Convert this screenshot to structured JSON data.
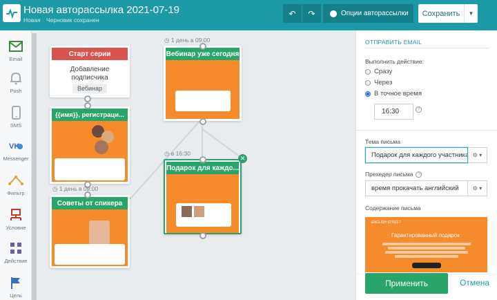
{
  "header": {
    "title": "Новая авторассылка 2021-07-19",
    "status_new": "Новая",
    "status_draft": "Черновик сохранен",
    "options_label": "Опции авторассылки",
    "save_label": "Сохранить",
    "undo_icon": "undo-icon",
    "redo_icon": "redo-icon"
  },
  "sidebar": {
    "items": [
      {
        "label": "Email",
        "icon": "email-icon",
        "color": "#3b8a3e"
      },
      {
        "label": "Push",
        "icon": "push-bell-icon",
        "color": "#a2acb1"
      },
      {
        "label": "SMS",
        "icon": "sms-phone-icon",
        "color": "#a2acb1"
      },
      {
        "label": "Messenger",
        "icon": "messenger-icon",
        "color": "#3b6fb8"
      },
      {
        "label": "Фильтр",
        "icon": "filter-icon",
        "color": "#e3a23a"
      },
      {
        "label": "Условие",
        "icon": "condition-icon",
        "color": "#c0392b"
      },
      {
        "label": "Действие",
        "icon": "action-icon",
        "color": "#6a5ea8"
      },
      {
        "label": "Цель",
        "icon": "goal-flag-icon",
        "color": "#3b6fb8"
      }
    ]
  },
  "canvas": {
    "start_node": {
      "header": "Старт серии",
      "line1": "Добавление",
      "line2": "подписчика",
      "button": "Вебинар"
    },
    "node_reg": {
      "header": "{{имя}}, регистраци..."
    },
    "node_tips": {
      "header": "Советы от спикера",
      "timing": "1 день в 09:00"
    },
    "node_webinar": {
      "header": "Вебинар уже сегодня",
      "timing": "1 день в 09:00"
    },
    "node_gift": {
      "header": "Подарок для каждо...",
      "timing": "в 16:30"
    }
  },
  "panel": {
    "section_title": "ОТПРАВИТЬ EMAIL",
    "action_label": "Выполнить действие:",
    "options": [
      {
        "label": "Сразу",
        "selected": false
      },
      {
        "label": "Через",
        "selected": false
      },
      {
        "label": "В точное время",
        "selected": true
      }
    ],
    "time_value": "16:30",
    "subject_label": "Тема письма",
    "subject_value": "Подарок для каждого участника",
    "preheader_label": "Прехедер письма",
    "preheader_value": "время прокачать английский",
    "content_label": "Содержание письма",
    "preview_logo": "ENGLISH STREET",
    "preview_title": "Гарантированный подарок",
    "apply_label": "Применить",
    "cancel_label": "Отмена"
  },
  "colors": {
    "topbar": "#1d9aa8",
    "start_header": "#d9534f",
    "node_header": "#27a56b",
    "email_orange": "#f58b2a",
    "apply": "#27a56b"
  }
}
